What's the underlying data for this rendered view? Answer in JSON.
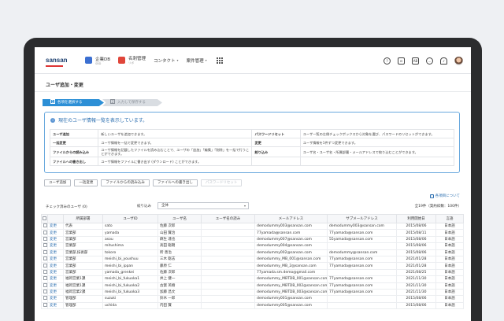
{
  "nav": {
    "logo": "sansan",
    "items": [
      {
        "label": "企業DB",
        "sub": "SBD",
        "color": "#3b6fd1"
      },
      {
        "label": "名刺管理",
        "sub": "リボ",
        "color": "#e0463a"
      },
      {
        "label": "コンタクト",
        "dropdown": true
      },
      {
        "label": "案件管理",
        "dropdown": true
      }
    ],
    "right_icons": [
      "help-icon",
      "card-icon",
      "address-icon",
      "chat-icon",
      "bell-icon",
      "avatar"
    ],
    "right_labels": [
      "?",
      "⊡",
      "AB",
      "…",
      "♪"
    ]
  },
  "page_title": "ユーザ追加・変更",
  "steps": [
    {
      "num": "1",
      "label": "各項を選択する"
    },
    {
      "num": "2",
      "label": "入力して保存する"
    }
  ],
  "info": {
    "title": "現在のユーザ情報一覧を表示しています。",
    "rows": [
      [
        "ユーザ追加",
        "新しいユーザを追加できます。",
        "パスワードリセット",
        "ユーザ一覧の左側チェックボックスから対象を選び、パスワードのリセットができます。"
      ],
      [
        "一括変更",
        "ユーザ情報を一括で変更できます。",
        "変更",
        "ユーザ情報を1件ずつ変更できます。"
      ],
      [
        "ファイルからの読み込み",
        "ユーザ情報を記載したファイルを読み込むことで、ユーザの「追加」「編集」「削除」を一括で行うことができます。",
        "絞り込み",
        "ユーザ名・ユーザ名・所属部署・メールアドレスで絞り込むことができます。"
      ],
      [
        "ファイルへの書き出し",
        "ユーザ情報をファイルに書き出す (ダウンロード) ことができます。",
        "",
        ""
      ]
    ]
  },
  "actions": [
    "ユーザ追加",
    "一括変更",
    "ファイルからの読み込み",
    "ファイルへの書き出し",
    "パスワードリセット"
  ],
  "help_link": "各項目について",
  "filter": {
    "checked_label": "チェック済みのユーザ (0)",
    "narrow_label": "絞り込み",
    "select_value": "全体",
    "total": "全19件（契約枠数：100件）"
  },
  "table": {
    "headers": [
      "",
      "",
      "所属部署",
      "ユーザID",
      "ユーザ名",
      "ユーザ名の読み",
      "メールアドレス",
      "サブメールアドレス",
      "利用開始日",
      "言語"
    ],
    "rows": [
      [
        "変更",
        "代表",
        "sato",
        "佐藤 次郎",
        "",
        "demodummy003@sansan.com",
        "demodummy003@sansan.com",
        "2015/08/06",
        "日本語"
      ],
      [
        "変更",
        "営業部",
        "yamada",
        "山田 賢治",
        "",
        "77yamada@sansan.com",
        "77yamada@sansan.com",
        "2015/08/11",
        "日本語"
      ],
      [
        "変更",
        "営業部",
        "asou",
        "麻生 達也",
        "",
        "demodummy007@sansan.com",
        "55yamada@sansan.com",
        "2015/08/06",
        "日本語"
      ],
      [
        "変更",
        "営業部",
        "mitushima",
        "高田 聡朗",
        "",
        "demodummy004@sansan.com",
        "",
        "2015/08/06",
        "日本語"
      ],
      [
        "変更",
        "営業部,技術部",
        "tokoro",
        "所 善治",
        "",
        "demodummy002@sansan.com",
        "demodummy@sansan.com",
        "2015/08/06",
        "日本語"
      ],
      [
        "変更",
        "営業部",
        "meishi_bi_youshuu",
        "三木 聡志",
        "",
        "demodummy_MB_001@sansan.com",
        "77yamada@sansan.com",
        "2021/01/28",
        "日本語"
      ],
      [
        "変更",
        "営業部",
        "meishi_bi_ippan",
        "藤原 仁",
        "",
        "demodummy_MB_2@sansan.com",
        "77yamada@sansan.com",
        "2021/01/28",
        "日本語"
      ],
      [
        "変更",
        "営業部",
        "yamada_grenkei",
        "佐藤 次郎",
        "",
        "77yamada.sm.demo@gmail.com",
        "",
        "2021/08/25",
        "日本語"
      ],
      [
        "変更",
        "福岡営業1課",
        "meishi_bi_fukuoka1",
        "井上 健一",
        "",
        "demodummy_MBTDB_001@sansan.com",
        "77yamada@sansan.com",
        "2021/11/30",
        "日本語"
      ],
      [
        "変更",
        "福岡営業1課",
        "meishi_bi_fukuoka2",
        "古賀 英樹",
        "",
        "demodummy_MBTDB_002@sansan.com",
        "77yamada@sansan.com",
        "2021/11/30",
        "日本語"
      ],
      [
        "変更",
        "福岡営業2課",
        "meishi_bi_fukuoka3",
        "加藤 昌文",
        "",
        "demodummy_MBTDB_003@sansan.com",
        "77yamada@sansan.com",
        "2021/11/30",
        "日本語"
      ],
      [
        "変更",
        "管理部",
        "suzuki",
        "鈴木 一郎",
        "",
        "demodummy001@sansan.com",
        "",
        "2015/08/06",
        "日本語"
      ],
      [
        "変更",
        "管理部",
        "uchida",
        "内田 賢",
        "",
        "demodummy005@sansan.com",
        "",
        "2015/08/06",
        "日本語"
      ]
    ]
  }
}
